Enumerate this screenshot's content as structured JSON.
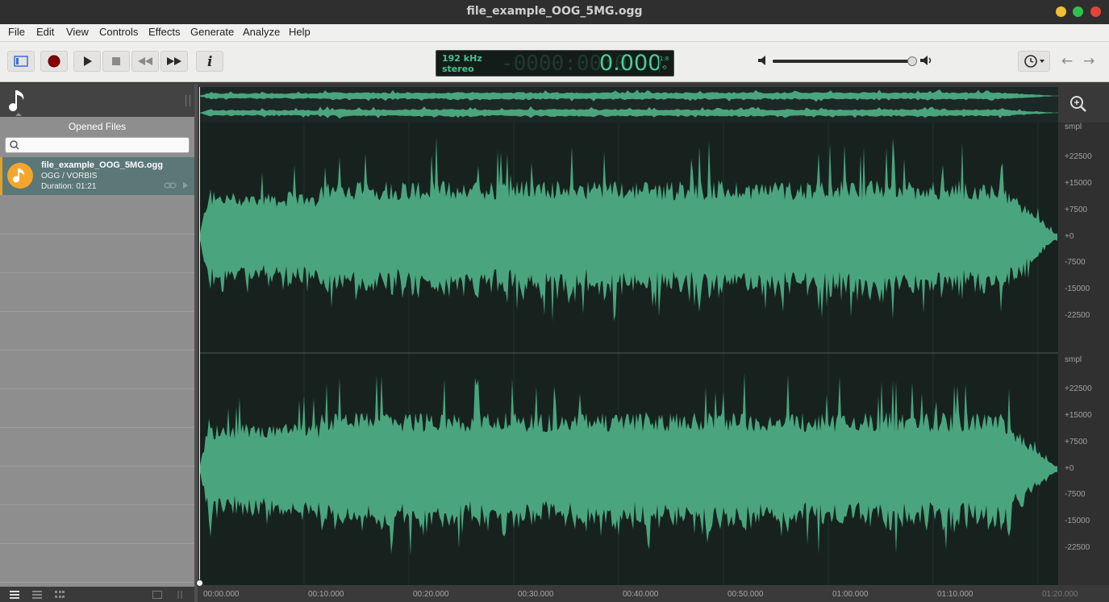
{
  "window": {
    "title": "file_example_OOG_5MG.ogg"
  },
  "menu": [
    "File",
    "Edit",
    "View",
    "Controls",
    "Effects",
    "Generate",
    "Analyze",
    "Help"
  ],
  "toolbar": {
    "display": {
      "rate": "192 kHz",
      "channels": "stereo",
      "ghost": "-0000:00:0",
      "time": "0.000",
      "side_top": "1:8",
      "side_bottom": "⟲"
    }
  },
  "sidebar": {
    "title": "Opened Files",
    "search_placeholder": "",
    "files": [
      {
        "name": "file_example_OOG_5MG.ogg",
        "format": "OGG / VORBIS",
        "duration": "Duration: 01:21"
      }
    ]
  },
  "ruler": {
    "unit": "smpl",
    "labels": [
      "+22500",
      "+15000",
      "+7500",
      "+0",
      "-7500",
      "-15000",
      "-22500"
    ]
  },
  "timeline": {
    "labels": [
      "00:00.000",
      "00:10.000",
      "00:20.000",
      "00:30.000",
      "00:40.000",
      "00:50.000",
      "01:00.000",
      "01:10.000",
      "01:20.000"
    ]
  },
  "colors": {
    "wave": "#4aa57e",
    "background": "#17221f",
    "accent": "#f4a62c"
  },
  "icons": [
    "track-list-icon",
    "record-icon",
    "play-icon",
    "stop-icon",
    "rewind-icon",
    "fast-forward-icon",
    "info-icon",
    "volume-low-icon",
    "volume-high-icon",
    "history-icon",
    "back-arrow-icon",
    "forward-arrow-icon",
    "music-note-icon",
    "search-icon",
    "zoom-in-icon",
    "link-icon"
  ]
}
